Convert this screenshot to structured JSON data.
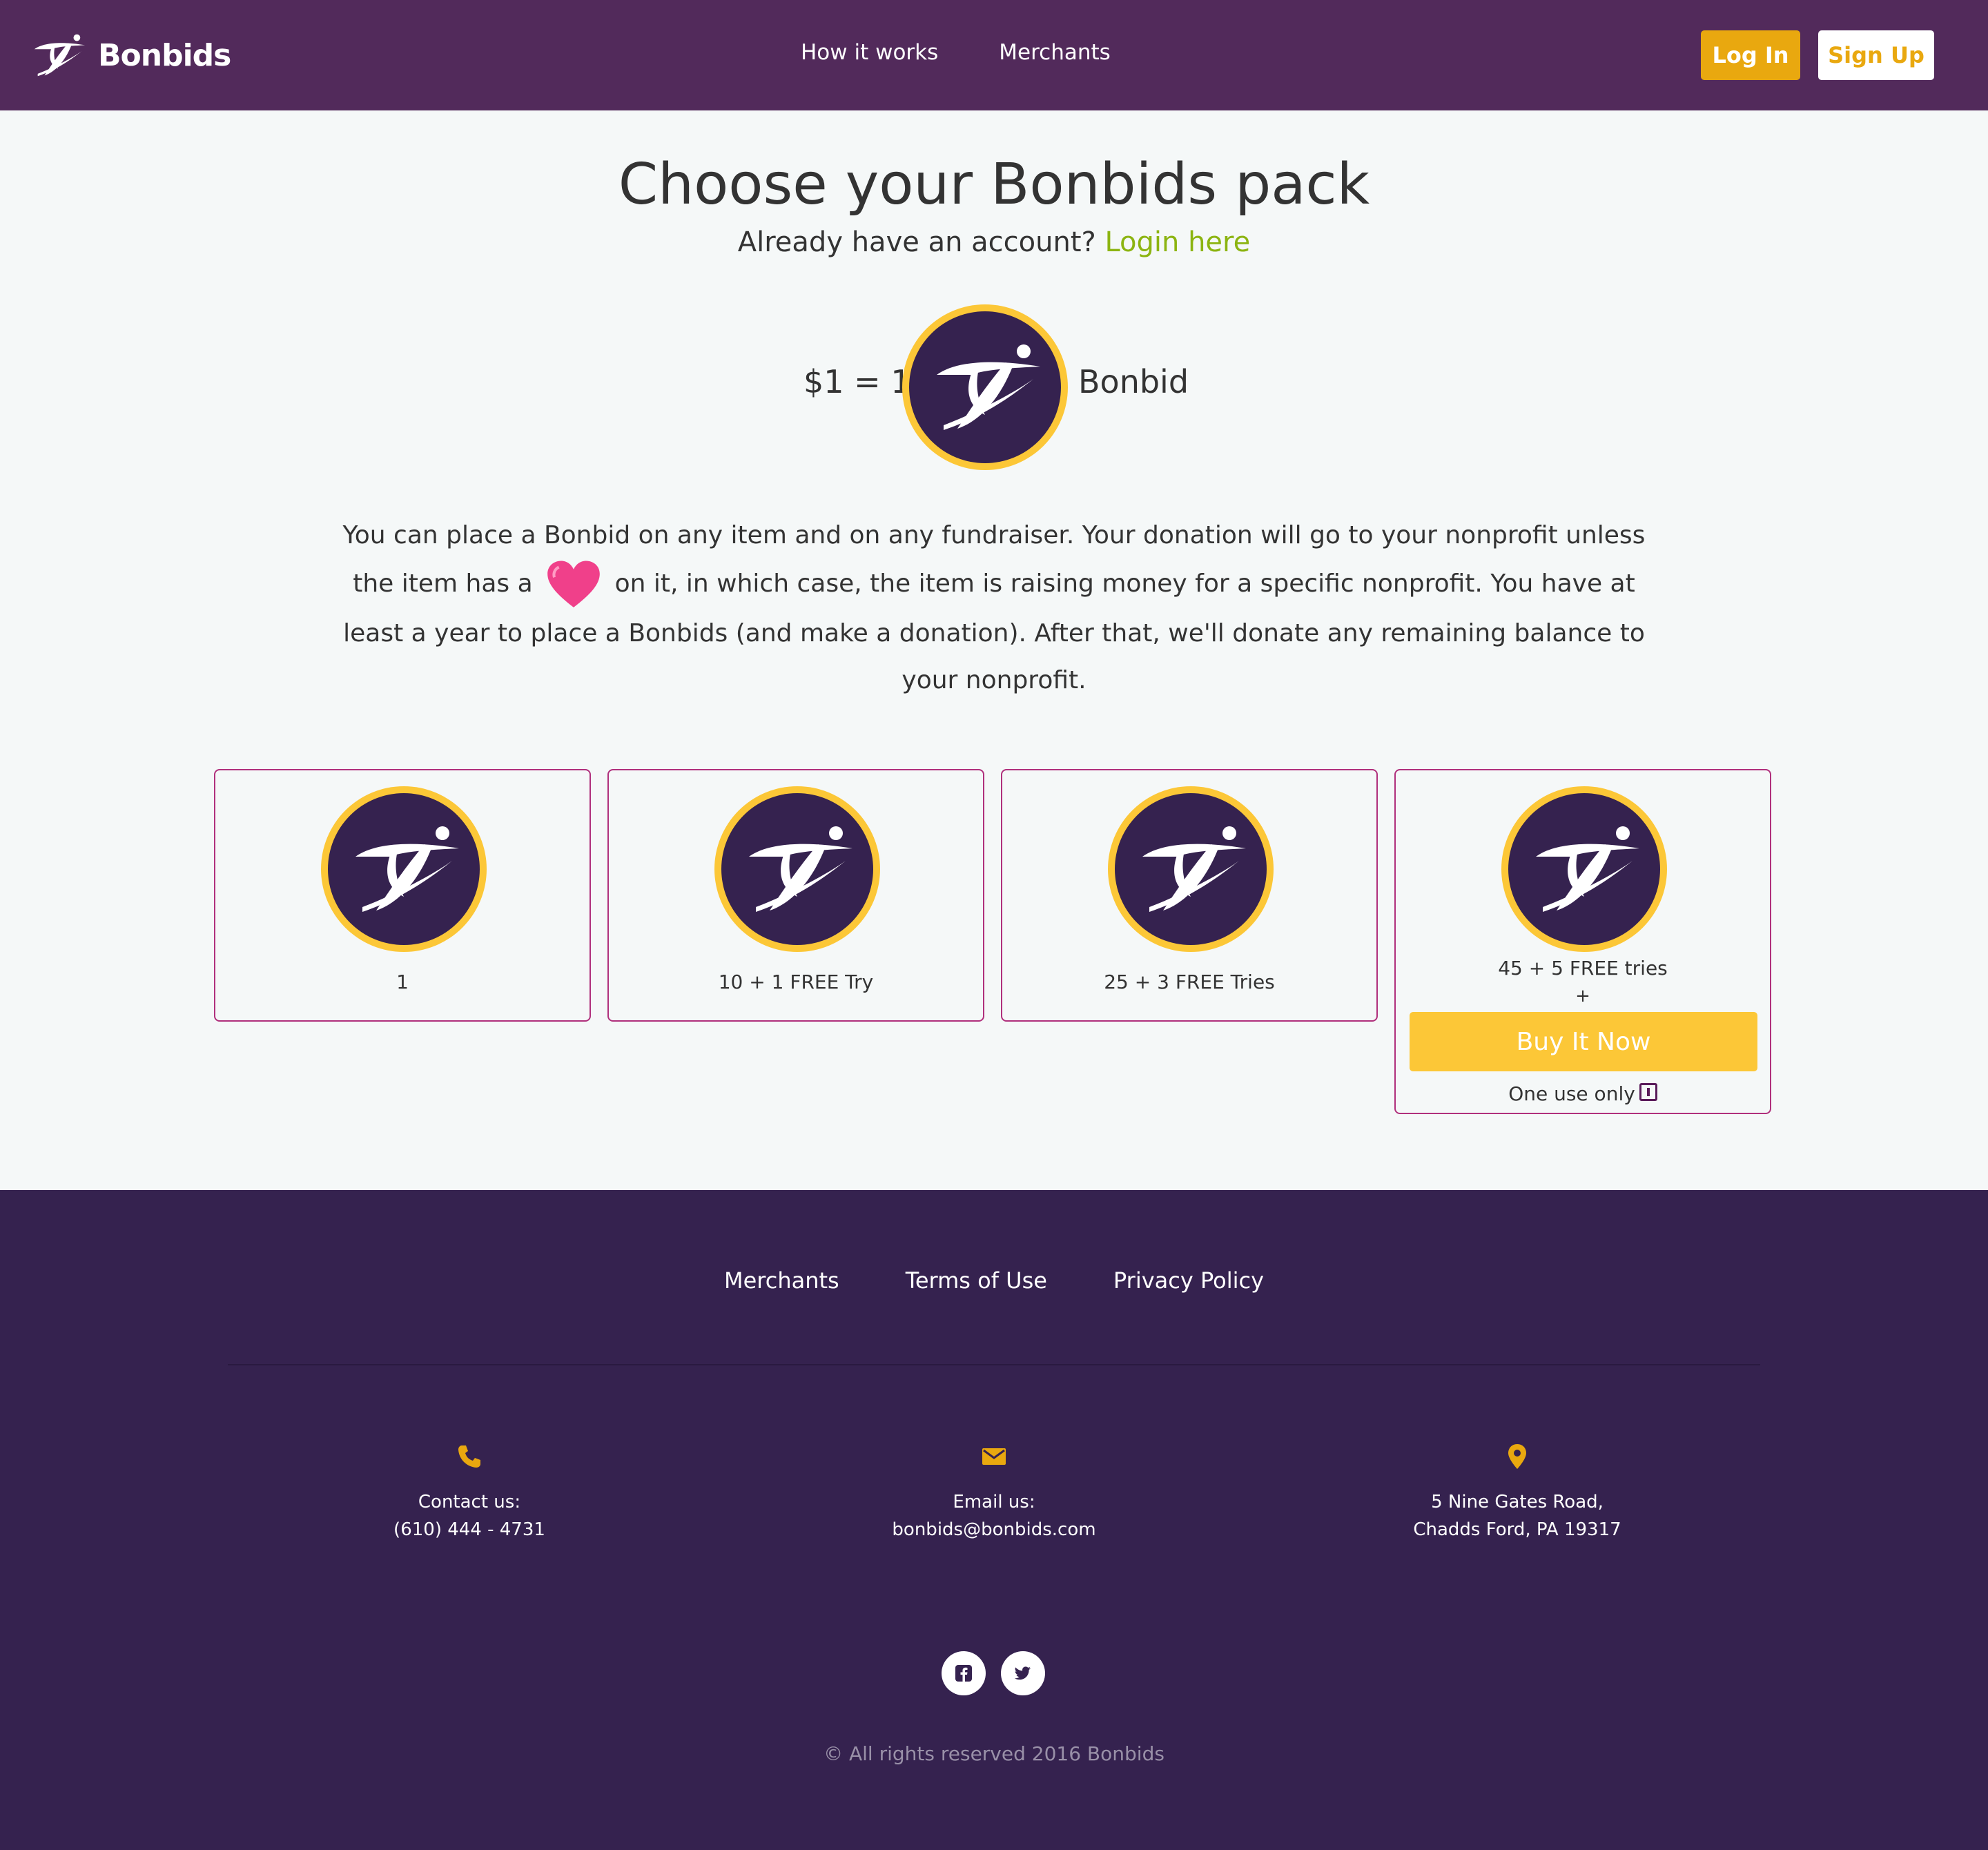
{
  "header": {
    "brand": "Bonbids",
    "nav": [
      "How it works",
      "Merchants"
    ],
    "login_label": "Log In",
    "signup_label": "Sign Up"
  },
  "main": {
    "title": "Choose your Bonbids pack",
    "subtitle_prefix": "Already have an account? ",
    "subtitle_link": "Login here",
    "rate_left": "$1 = 1",
    "rate_right": "Bonbid",
    "description_part1": "You can place a Bonbid on any item and on any fundraiser. Your donation will go to your nonprofit unless the item has a",
    "description_part2": "on it, in which case, the item is raising money for a specific nonprofit. You have at least a year to place a Bonbids (and make a donation). After that, we'll donate any remaining balance to your nonprofit.",
    "packs": [
      {
        "label": "1"
      },
      {
        "label": "10 + 1 FREE Try"
      },
      {
        "label": "25 + 3 FREE Tries"
      },
      {
        "label": "45 + 5 FREE tries",
        "plus": "+",
        "buy_label": "Buy It Now",
        "note": "One use only"
      }
    ]
  },
  "footer": {
    "links": [
      "Merchants",
      "Terms of Use",
      "Privacy Policy"
    ],
    "contact": {
      "label": "Contact us:",
      "value": "(610) 444 - 4731",
      "icon": "phone-icon"
    },
    "email": {
      "label": "Email us:",
      "value": "bonbids@bonbids.com",
      "icon": "mail-icon"
    },
    "address": {
      "line1": "5 Nine Gates Road,",
      "line2": "Chadds Ford, PA 19317",
      "icon": "location-pin-icon"
    },
    "social": [
      "facebook-icon",
      "twitter-icon"
    ],
    "copyright": "© All rights reserved 2016 Bonbids"
  },
  "colors": {
    "header_bg": "#522a5b",
    "footer_bg": "#35224f",
    "accent_gold": "#e9a80f",
    "buy_button": "#fcc737",
    "link_green": "#8cb411",
    "pack_border": "#b0307c",
    "coin_bg": "#35224f",
    "coin_ring": "#fcc737"
  }
}
